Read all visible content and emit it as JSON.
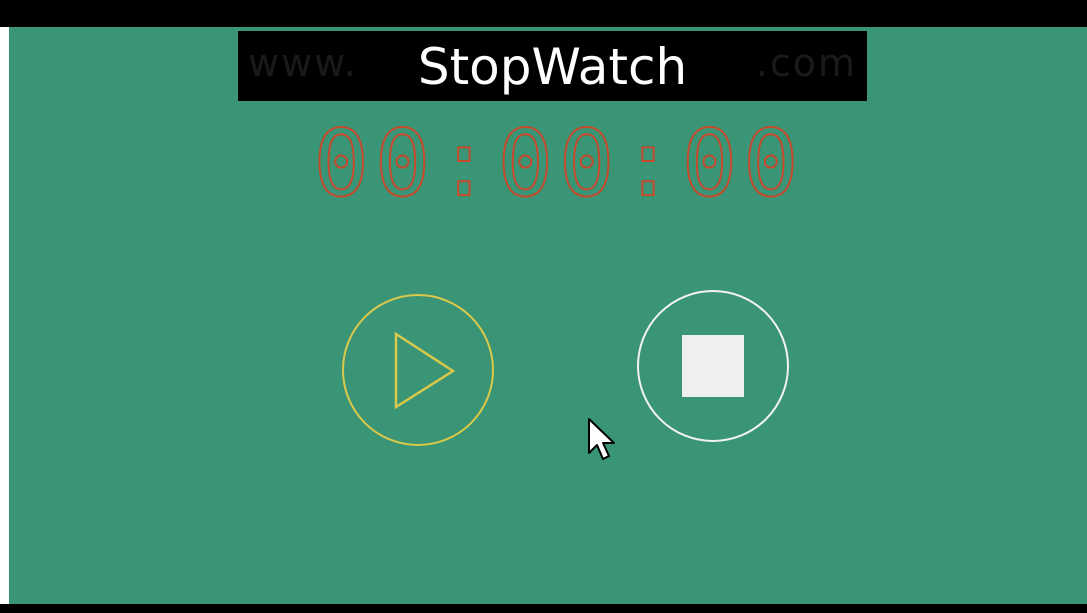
{
  "app": {
    "title": "StopWatch",
    "watermark_left": "www.",
    "watermark_right": ".com"
  },
  "display": {
    "time": "00:00:00"
  },
  "controls": {
    "play_icon": "play-icon",
    "stop_icon": "stop-icon"
  },
  "colors": {
    "background": "#3a9577",
    "digits": "#c54a2c",
    "play_outline": "#d9c84a",
    "stop_outline": "#f2f2f2"
  }
}
